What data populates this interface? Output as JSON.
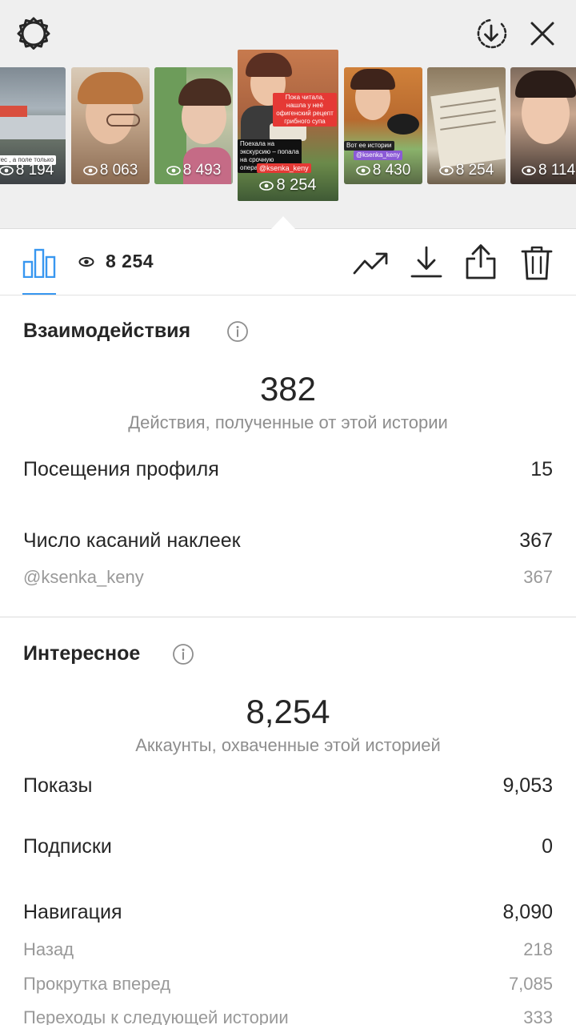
{
  "story_strip": {
    "thumbnails": [
      {
        "views": "8 194"
      },
      {
        "views": "8 063"
      },
      {
        "views": "8 493"
      },
      {
        "views": "8 254",
        "selected": true
      },
      {
        "views": "8 430"
      },
      {
        "views": "8 254"
      },
      {
        "views": "8 114"
      }
    ],
    "captions": {
      "t1": "тес , а поле только",
      "s1": "Пока читала, нашла у неё офигенский рецепт грибного супа",
      "s2": "Поехала на экскурсию – попала на срочную операцию!",
      "s3": "@ksenka_keny",
      "s4": "Вот ее истории",
      "s5": "@ksenka_keny"
    }
  },
  "toolbar": {
    "view_count": "8 254"
  },
  "interactions": {
    "title": "Взаимодействия",
    "total": "382",
    "total_label": "Действия, полученные от этой истории",
    "rows": [
      {
        "label": "Посещения профиля",
        "value": "15"
      },
      {
        "label": "Число касаний наклеек",
        "value": "367"
      },
      {
        "label": "@ksenka_keny",
        "value": "367"
      }
    ]
  },
  "discovery": {
    "title": "Интересное",
    "total": "8,254",
    "total_label": "Аккаунты, охваченные этой историей",
    "rows": [
      {
        "label": "Показы",
        "value": "9,053"
      },
      {
        "label": "Подписки",
        "value": "0"
      },
      {
        "label": "Навигация",
        "value": "8,090"
      },
      {
        "label": "Назад",
        "value": "218"
      },
      {
        "label": "Прокрутка вперед",
        "value": "7,085"
      },
      {
        "label": "Переходы к следующей истории",
        "value": "333"
      }
    ]
  },
  "colors": {
    "accent": "#3897f0",
    "text": "#262626",
    "muted": "#8e8e8e"
  }
}
